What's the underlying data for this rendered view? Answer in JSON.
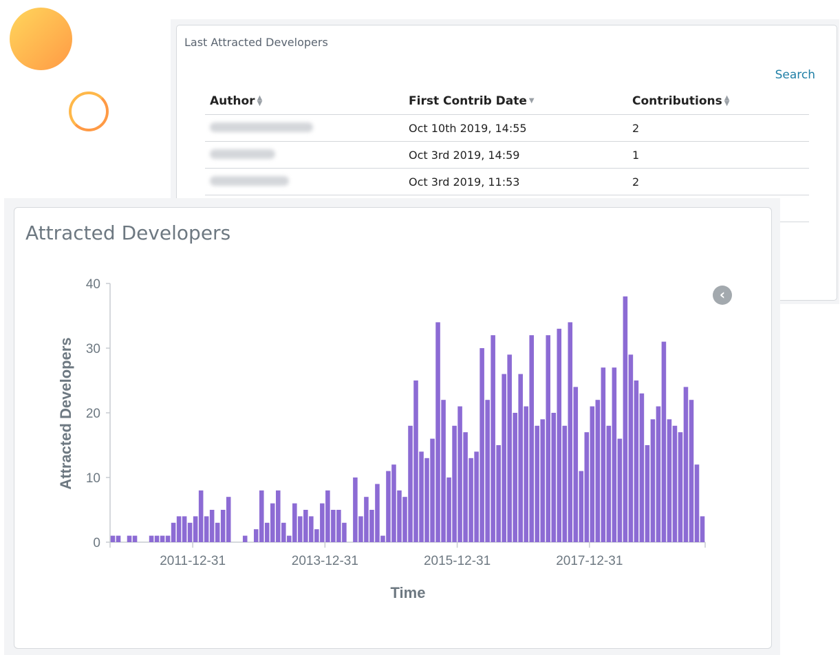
{
  "table_panel": {
    "title": "Last Attracted Developers",
    "search_label": "Search",
    "columns": [
      "Author",
      "First Contrib Date",
      "Contributions"
    ],
    "rows": [
      {
        "author": "",
        "date": "Oct 10th 2019, 14:55",
        "contributions": "2"
      },
      {
        "author": "",
        "date": "Oct 3rd 2019, 14:59",
        "contributions": "1"
      },
      {
        "author": "",
        "date": "Oct 3rd 2019, 11:53",
        "contributions": "2"
      },
      {
        "author": "",
        "date": "",
        "contributions": ""
      }
    ]
  },
  "chart_panel": {
    "title": "Attracted Developers"
  },
  "chart_data": {
    "type": "bar",
    "xlabel": "Time",
    "ylabel": "Attracted Developers",
    "ylim": [
      0,
      40
    ],
    "yticks": [
      "0",
      "10",
      "20",
      "30",
      "40"
    ],
    "xticks": [
      "2011-12-31",
      "2013-12-31",
      "2015-12-31",
      "2017-12-31"
    ],
    "bar_color": "#8c6bd4",
    "x_start": "2010-10",
    "x_end": "2019-10",
    "x_interval": "month",
    "values": [
      1,
      1,
      0,
      1,
      1,
      0,
      0,
      1,
      1,
      1,
      1,
      3,
      4,
      4,
      3,
      4,
      8,
      4,
      5,
      3,
      5,
      7,
      0,
      0,
      1,
      0,
      2,
      8,
      3,
      6,
      8,
      3,
      1,
      6,
      4,
      5,
      4,
      2,
      6,
      8,
      5,
      5,
      3,
      0,
      10,
      4,
      7,
      5,
      9,
      1,
      11,
      12,
      8,
      7,
      18,
      25,
      14,
      13,
      16,
      34,
      22,
      10,
      18,
      21,
      17,
      13,
      14,
      30,
      22,
      32,
      15,
      26,
      29,
      20,
      26,
      21,
      32,
      18,
      19,
      32,
      20,
      33,
      18,
      34,
      24,
      11,
      17,
      21,
      22,
      27,
      18,
      27,
      16,
      38,
      29,
      25,
      23,
      15,
      19,
      21,
      31,
      19,
      18,
      17,
      24,
      22,
      12,
      4
    ]
  }
}
